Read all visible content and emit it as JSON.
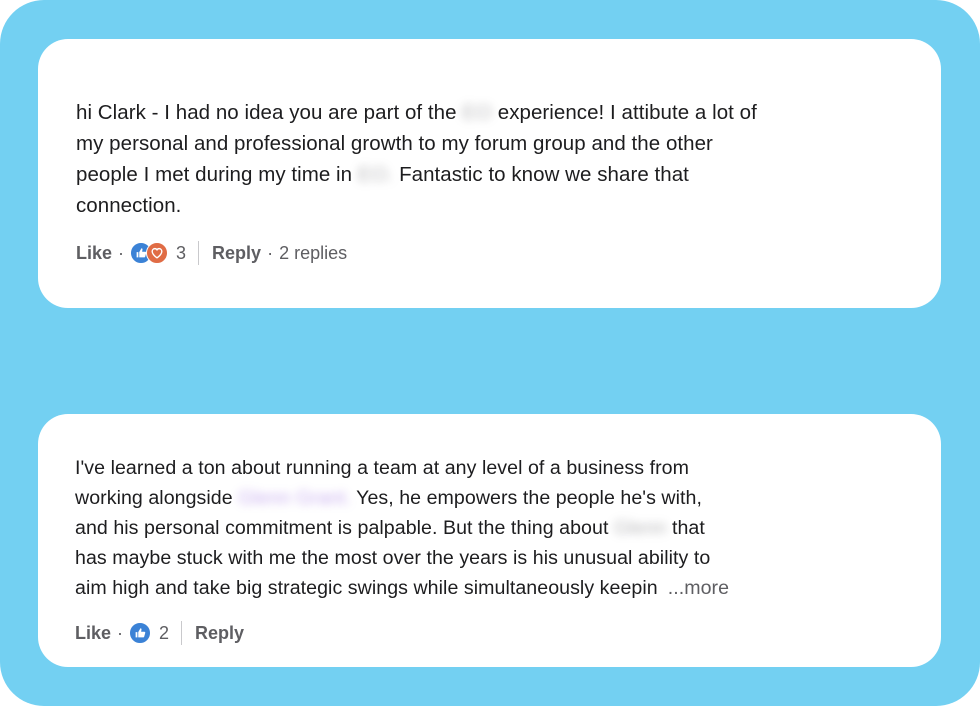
{
  "comments": [
    {
      "segments": {
        "line1a": "hi Clark - I had no idea you are part of the",
        "redacted1": "EO",
        "line1b": " experience! I attibute a lot of",
        "line2": "my personal and professional growth to my forum group and the other",
        "line3a": "people I met during my time in",
        "redacted2": "EO.",
        "line3b": " Fantastic to know we share that",
        "line4": "connection."
      },
      "like_label": "Like",
      "reaction_icons": [
        "like-icon",
        "love-icon"
      ],
      "reaction_count": "3",
      "reply_label": "Reply",
      "replies_text": "2 replies"
    },
    {
      "segments": {
        "line1": "I've learned a ton about running a team at any level of a business from",
        "line2a": "working alongside",
        "redacted1": "Glenn Grant.",
        "line2b": " Yes, he empowers the people he's with,",
        "line3a": "and his personal commitment is palpable. But the thing about",
        "redacted2": "Glenn",
        "line3b": " that",
        "line4": "has maybe stuck with me the most over the years is his unusual ability to",
        "line5": "aim high and take big strategic swings while simultaneously keepin"
      },
      "more_label": "...more",
      "like_label": "Like",
      "reaction_icons": [
        "like-icon"
      ],
      "reaction_count": "2",
      "reply_label": "Reply"
    }
  ],
  "colors": {
    "background": "#73d0f2",
    "card": "#ffffff",
    "like_reaction": "#3b82d6",
    "love_reaction": "#e06c45"
  }
}
